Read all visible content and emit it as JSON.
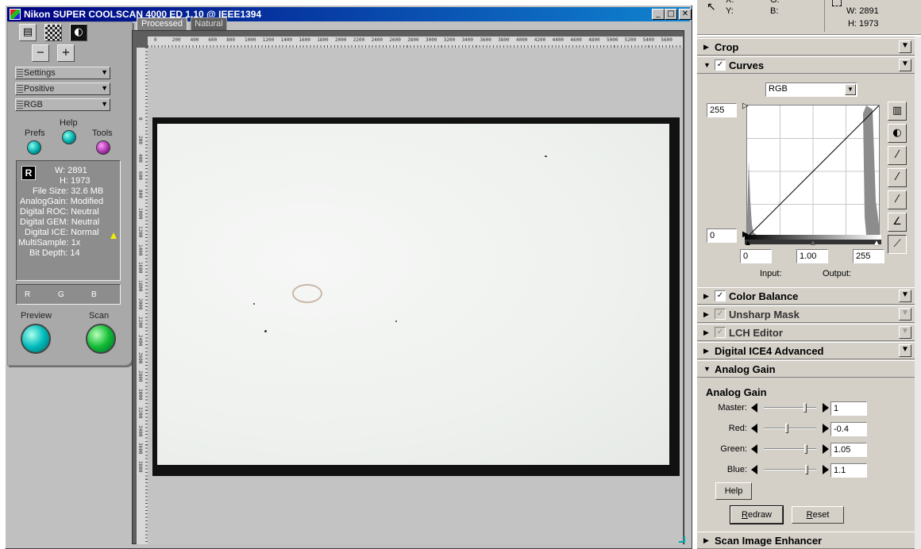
{
  "window": {
    "title": "Nikon SUPER COOLSCAN 4000 ED 1.10 @ IEEE1394",
    "minimize": "_",
    "maximize": "□",
    "close": "✕"
  },
  "left_panel": {
    "dropdowns": [
      "Settings",
      "Positive",
      "RGB"
    ],
    "prefs_label": "Prefs",
    "help_label": "Help",
    "tools_label": "Tools",
    "info": {
      "badge": "R",
      "width": "W: 2891",
      "height": "H: 1973",
      "file_size": "File Size: 32.6 MB",
      "analog_gain": "AnalogGain: Modified",
      "digital_roc": "Digital ROC: Neutral",
      "digital_gem": "Digital GEM: Neutral",
      "digital_ice": "Digital ICE: Normal",
      "multisample": "MultiSample: 1x",
      "bit_depth": "Bit Depth: 14"
    },
    "channels": [
      "R",
      "G",
      "B"
    ],
    "preview_label": "Preview",
    "scan_label": "Scan"
  },
  "preview": {
    "tabs": [
      "Processed",
      "Natural"
    ],
    "hruler_ticks": [
      "0",
      "200",
      "400",
      "600",
      "800",
      "1000",
      "1200",
      "1400",
      "1600",
      "1800",
      "2000",
      "2200",
      "2400",
      "2600",
      "2800",
      "3000",
      "3200",
      "3400",
      "3600",
      "3800",
      "4000",
      "4200",
      "4400",
      "4600",
      "4800",
      "5000",
      "5200",
      "5400",
      "5600"
    ],
    "vruler_ticks": [
      "0",
      "200",
      "400",
      "600",
      "800",
      "1000",
      "1200",
      "1400",
      "1600",
      "1800",
      "2000",
      "2200",
      "2400",
      "2600",
      "2800",
      "3000",
      "3200",
      "3400",
      "3600",
      "3800"
    ]
  },
  "top_readout": {
    "x_label": "X:",
    "y_label": "Y:",
    "g_label": "G:",
    "b_label": "B:",
    "w_label": "W: 2891",
    "h_label": "H: 1973"
  },
  "sections": {
    "crop": "Crop",
    "curves": "Curves",
    "color_balance": "Color Balance",
    "unsharp_mask": "Unsharp Mask",
    "lch_editor": "LCH Editor",
    "digital_ice4": "Digital ICE4 Advanced",
    "analog_gain": "Analog Gain",
    "scan_image_enhancer": "Scan Image Enhancer"
  },
  "curves": {
    "channel": "RGB",
    "max_output": "255",
    "min_output": "0",
    "input_black": "0",
    "gamma": "1.00",
    "input_white": "255",
    "input_label": "Input:",
    "output_label": "Output:"
  },
  "analog_gain": {
    "heading": "Analog Gain",
    "rows": [
      {
        "label": "Master:",
        "value": "1",
        "level": 0.8
      },
      {
        "label": "Red:",
        "value": "-0.4",
        "level": 0.44
      },
      {
        "label": "Green:",
        "value": "1.05",
        "level": 0.82
      },
      {
        "label": "Blue:",
        "value": "1.1",
        "level": 0.84
      }
    ],
    "help_button": "Help",
    "redraw_button": "Redraw",
    "reset_button": "Reset"
  }
}
